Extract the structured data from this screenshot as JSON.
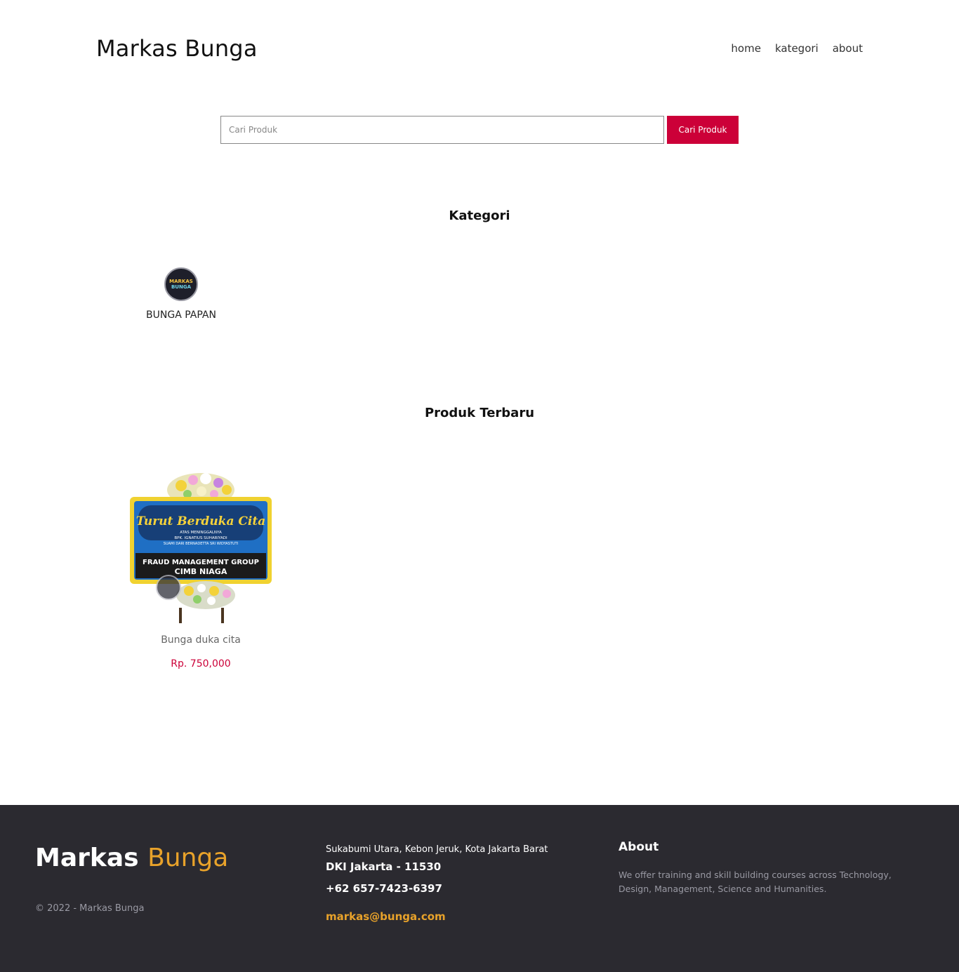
{
  "header": {
    "brand": "Markas Bunga",
    "nav": [
      "home",
      "kategori",
      "about"
    ]
  },
  "search": {
    "placeholder": "Cari Produk",
    "button_label": "Cari Produk"
  },
  "kategori": {
    "title": "Kategori",
    "items": [
      {
        "label": "BUNGA PAPAN",
        "logo_text": [
          "MARKAS",
          "BUNGA"
        ]
      }
    ]
  },
  "produk": {
    "title": "Produk Terbaru",
    "items": [
      {
        "name": "Bunga duka cita",
        "price": "Rp. 750,000",
        "image_text": {
          "heading": "Turut Berduka Cita",
          "line1": "ATAS MENINGGALNYA",
          "line2": "BPK. IGNATIUS SUHARIYADI",
          "line3": "SUAMI DARI BERNADETTA SRI WIDYASTUTI",
          "line4": "FRAUD MANAGEMENT GROUP",
          "line5": "CIMB NIAGA"
        }
      }
    ]
  },
  "footer": {
    "brand_part1": "Markas",
    "brand_part2": "Bunga",
    "copyright": "© 2022 - Markas Bunga",
    "address_line1": "Sukabumi Utara, Kebon Jeruk, Kota Jakarta Barat",
    "address_line2": "DKI Jakarta - 11530",
    "phone": "+62 657-7423-6397",
    "email": "markas@bunga.com",
    "about_title": "About",
    "about_text": "We offer training and skill building courses across Technology, Design, Management, Science and Humanities."
  },
  "colors": {
    "accent": "#cc0038",
    "footer_bg": "#2b2a30",
    "footer_accent": "#e8a22a"
  }
}
